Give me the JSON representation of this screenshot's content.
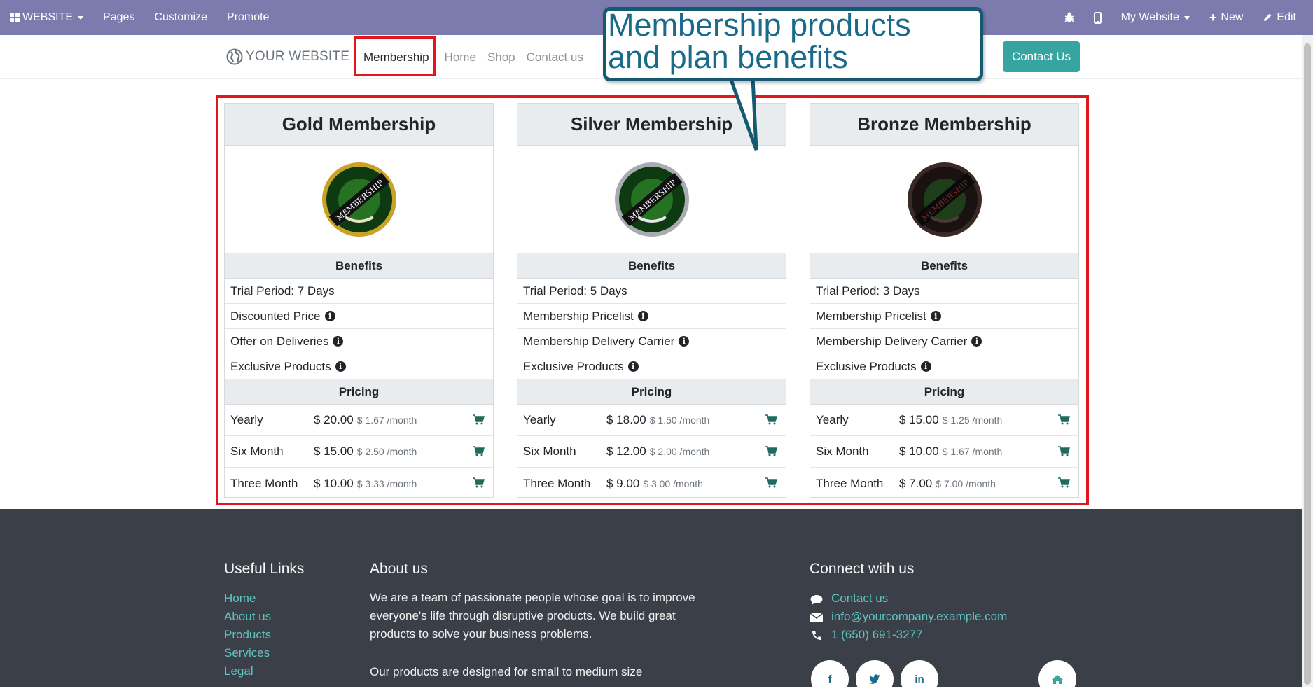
{
  "topbar": {
    "website_label": "WEBSITE",
    "pages_label": "Pages",
    "customize_label": "Customize",
    "promote_label": "Promote",
    "my_website_label": "My Website",
    "new_label": "New",
    "edit_label": "Edit"
  },
  "header": {
    "logo_text": "YOUR WEBSITE",
    "nav": [
      "Membership",
      "Home",
      "Shop",
      "Contact us"
    ],
    "contact_button": "Contact Us"
  },
  "callout": {
    "line1": "Membership products",
    "line2": "and plan benefits"
  },
  "cards": [
    {
      "title": "Gold Membership",
      "badge_color": "#c9a227",
      "benefits_label": "Benefits",
      "benefits": [
        "Trial Period: 7 Days",
        "Discounted Price",
        "Offer on Deliveries",
        "Exclusive Products"
      ],
      "pricing_label": "Pricing",
      "pricing": [
        {
          "period": "Yearly",
          "price": "$ 20.00",
          "per_month": "$ 1.67 /month"
        },
        {
          "period": "Six Month",
          "price": "$ 15.00",
          "per_month": "$ 2.50 /month"
        },
        {
          "period": "Three Month",
          "price": "$ 10.00",
          "per_month": "$ 3.33 /month"
        }
      ]
    },
    {
      "title": "Silver Membership",
      "badge_color": "#a8acb0",
      "benefits_label": "Benefits",
      "benefits": [
        "Trial Period: 5 Days",
        "Membership Pricelist",
        "Membership Delivery Carrier",
        "Exclusive Products"
      ],
      "pricing_label": "Pricing",
      "pricing": [
        {
          "period": "Yearly",
          "price": "$ 18.00",
          "per_month": "$ 1.50 /month"
        },
        {
          "period": "Six Month",
          "price": "$ 12.00",
          "per_month": "$ 2.00 /month"
        },
        {
          "period": "Three Month",
          "price": "$ 9.00",
          "per_month": "$ 3.00 /month"
        }
      ]
    },
    {
      "title": "Bronze Membership",
      "badge_color": "#3a2a26",
      "benefits_label": "Benefits",
      "benefits": [
        "Trial Period: 3 Days",
        "Membership Pricelist",
        "Membership Delivery Carrier",
        "Exclusive Products"
      ],
      "pricing_label": "Pricing",
      "pricing": [
        {
          "period": "Yearly",
          "price": "$ 15.00",
          "per_month": "$ 1.25 /month"
        },
        {
          "period": "Six Month",
          "price": "$ 10.00",
          "per_month": "$ 1.67 /month"
        },
        {
          "period": "Three Month",
          "price": "$ 7.00",
          "per_month": "$ 7.00 /month"
        }
      ]
    }
  ],
  "badge_text": "MEMBERSHIP",
  "footer": {
    "useful_links_title": "Useful Links",
    "useful_links": [
      "Home",
      "About us",
      "Products",
      "Services",
      "Legal"
    ],
    "about_title": "About us",
    "about_p1_lines": [
      "We are a team of passionate people whose goal is to improve",
      "everyone's life through disruptive products. We build great",
      "products to solve your business problems."
    ],
    "about_p2": "Our products are designed for small to medium size",
    "connect_title": "Connect with us",
    "connect_contact": "Contact us",
    "connect_email": "info@yourcompany.example.com",
    "connect_phone": "1 (650) 691-3277",
    "social": [
      "f",
      "t",
      "in"
    ]
  },
  "colors": {
    "topbar": "#7c7bad",
    "accent": "#36a4a0",
    "highlight": "#e2161d",
    "footer": "#3b4048"
  }
}
